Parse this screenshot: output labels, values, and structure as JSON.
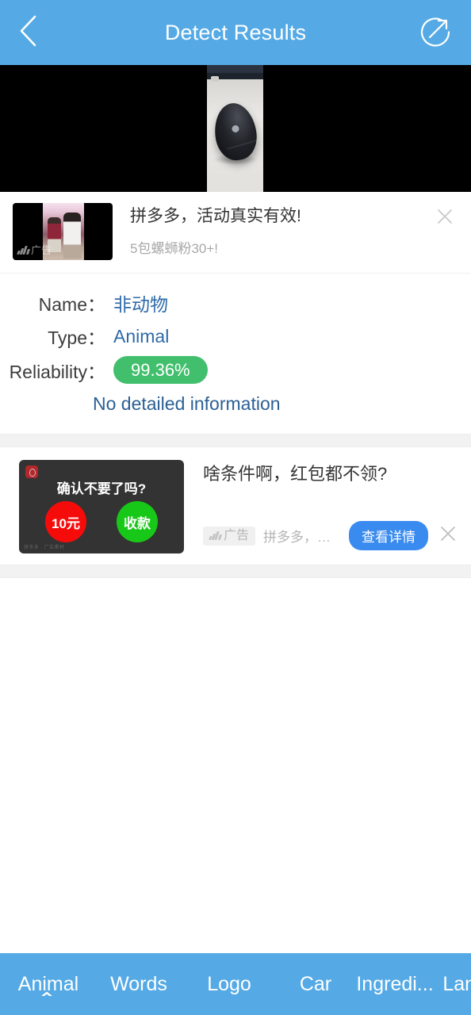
{
  "header": {
    "title": "Detect Results",
    "back_icon": "chevron-left-icon",
    "share_icon": "share-icon",
    "background_color": "#55aae5"
  },
  "photo": {
    "alt": "black wireless computer mouse on a white desk",
    "background_color": "#000000"
  },
  "ad_top": {
    "title": "拼多多，活动真实有效!",
    "subtitle": "5包螺蛳粉30+!",
    "thumb_watermark": "广告",
    "close_icon": "close-icon"
  },
  "result": {
    "rows": [
      {
        "label": "Name：",
        "value": "非动物",
        "type": "text"
      },
      {
        "label": "Type：",
        "value": "Animal",
        "type": "text"
      },
      {
        "label": "Reliability：",
        "value": "99.36%",
        "type": "pill"
      }
    ],
    "detail_link": "No detailed information",
    "pill_color": "#41bf6d",
    "value_color": "#2f6ba8"
  },
  "ad_bottom": {
    "thumb": {
      "headline": "确认不要了吗?",
      "button_left": "10元",
      "button_right": "收款",
      "watermark": "拼多多 · 广告素材",
      "left_color": "#f60b0b",
      "right_color": "#18c818"
    },
    "title": "啥条件啊，红包都不领?",
    "badge": "广告",
    "brand": "拼多多，活...",
    "cta": "查看详情",
    "cta_color": "#3a8bf0",
    "close_icon": "close-icon"
  },
  "tabbar": {
    "background_color": "#55aae5",
    "active_index": 0,
    "items": [
      {
        "label": "Animal"
      },
      {
        "label": "Words"
      },
      {
        "label": "Logo"
      },
      {
        "label": "Car"
      },
      {
        "label": "Ingredi..."
      },
      {
        "label": "LandM..."
      }
    ]
  }
}
